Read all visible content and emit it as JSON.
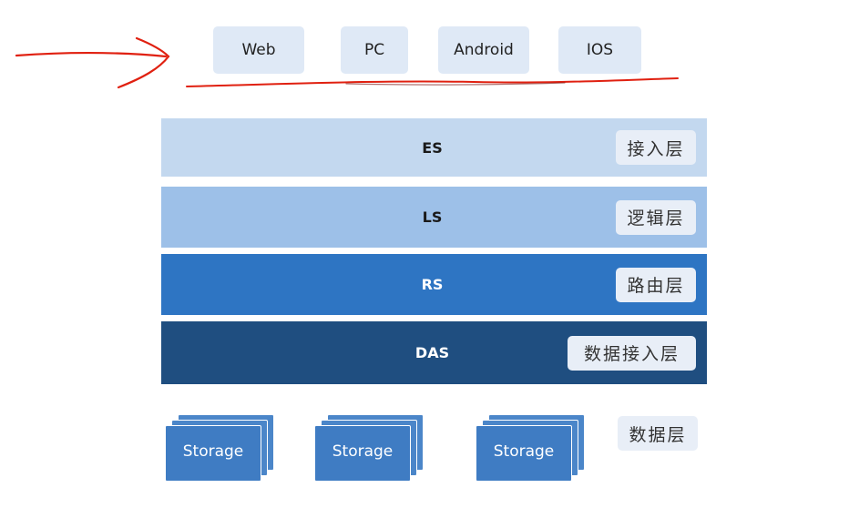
{
  "clients": [
    {
      "label": "Web"
    },
    {
      "label": "PC"
    },
    {
      "label": "Android"
    },
    {
      "label": "IOS"
    }
  ],
  "layers": [
    {
      "name": "ES",
      "badge": "接入层",
      "color": "#c3d8ef",
      "text_color": "#1a1a1a"
    },
    {
      "name": "LS",
      "badge": "逻辑层",
      "color": "#9dc0e8",
      "text_color": "#1a1a1a"
    },
    {
      "name": "RS",
      "badge": "路由层",
      "color": "#2e75c3",
      "text_color": "#ffffff"
    },
    {
      "name": "DAS",
      "badge": "数据接入层",
      "color": "#1f4e80",
      "text_color": "#ffffff"
    }
  ],
  "storage": [
    {
      "label": "Storage"
    },
    {
      "label": "Storage"
    },
    {
      "label": "Storage"
    }
  ],
  "data_layer_label": "数据层",
  "annotation_color": "#e02010"
}
